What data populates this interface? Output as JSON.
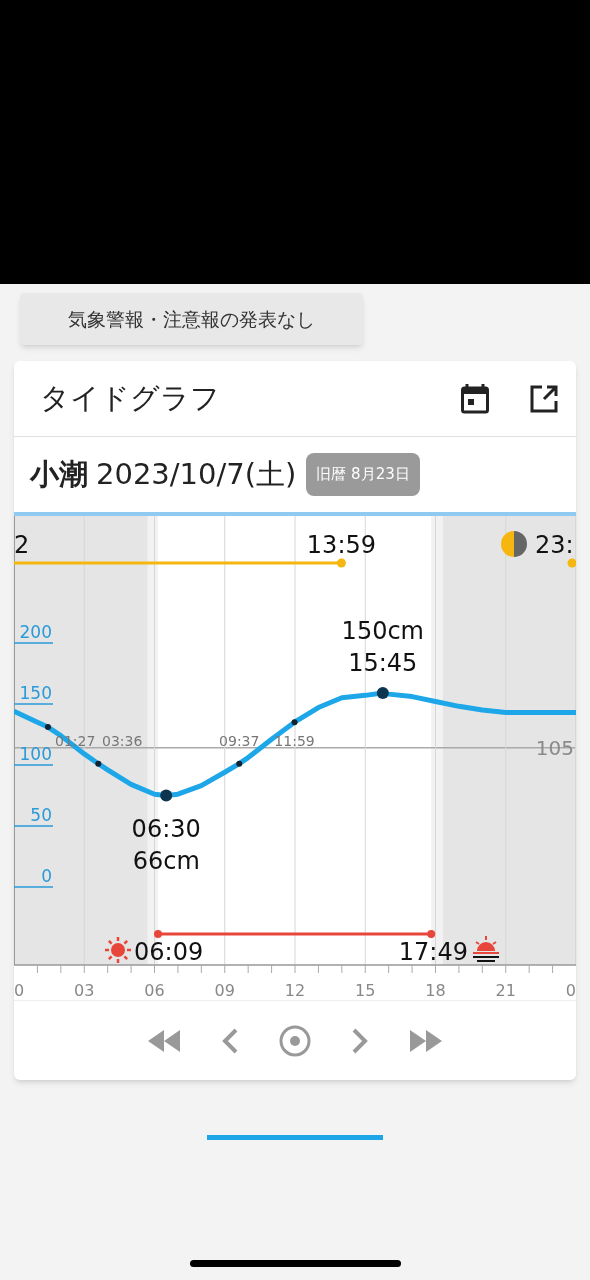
{
  "warning_button": "気象警報・注意報の発表なし",
  "card": {
    "title": "タイドグラフ",
    "tide_name": "小潮",
    "date": "2023/10/7(土)",
    "lunar_badge": "旧暦 8月23日",
    "chart": {
      "moon": {
        "left_text": "2",
        "set": "13:59",
        "rise": "23:"
      },
      "sun": {
        "rise": "06:09",
        "set": "17:49"
      },
      "axis_end_label": "0",
      "reference_label": "105",
      "chart_data": {
        "type": "line",
        "x": [
          0,
          1,
          1.45,
          2,
          3,
          3.6,
          4,
          5,
          6,
          6.5,
          7,
          8,
          9,
          9.62,
          10,
          11,
          11.98,
          13,
          14,
          15,
          15.75,
          16,
          17,
          18,
          19,
          20,
          21,
          22,
          23,
          24
        ],
        "series": [
          {
            "color": "#1ea7e8",
            "values": [
              135,
              126,
              122,
              115,
              100,
              92,
              87,
              75,
              67,
              66,
              67,
              74,
              85,
              92,
              97,
              112,
              126,
              138,
              146,
              148,
              150,
              149,
              147,
              143,
              139,
              136,
              134,
              134,
              134,
              134
            ]
          }
        ],
        "xlim": [
          0,
          24
        ],
        "ylim": [
          -73,
          295
        ],
        "xticks": [
          {
            "value": 0,
            "label": "0"
          },
          {
            "value": 3,
            "label": "03"
          },
          {
            "value": 6,
            "label": "06"
          },
          {
            "value": 9,
            "label": "09"
          },
          {
            "value": 12,
            "label": "12"
          },
          {
            "value": 15,
            "label": "15"
          },
          {
            "value": 18,
            "label": "18"
          },
          {
            "value": 21,
            "label": "21"
          }
        ],
        "yticks": [
          0,
          50,
          100,
          150,
          200
        ],
        "grid": true,
        "annotations": [
          {
            "x": 1.45,
            "y": 122,
            "text": "01:27"
          },
          {
            "x": 3.6,
            "y": 92,
            "text": "03:36"
          },
          {
            "x": 6.5,
            "y": 66,
            "text": "06:30"
          },
          {
            "x": 6.5,
            "y": 66,
            "text": "66cm"
          },
          {
            "x": 9.62,
            "y": 92,
            "text": "09:37"
          },
          {
            "x": 11.98,
            "y": 126,
            "text": "11:59"
          },
          {
            "x": 15.75,
            "y": 150,
            "text": "150cm"
          },
          {
            "x": 15.75,
            "y": 150,
            "text": "15:45"
          }
        ]
      }
    }
  }
}
